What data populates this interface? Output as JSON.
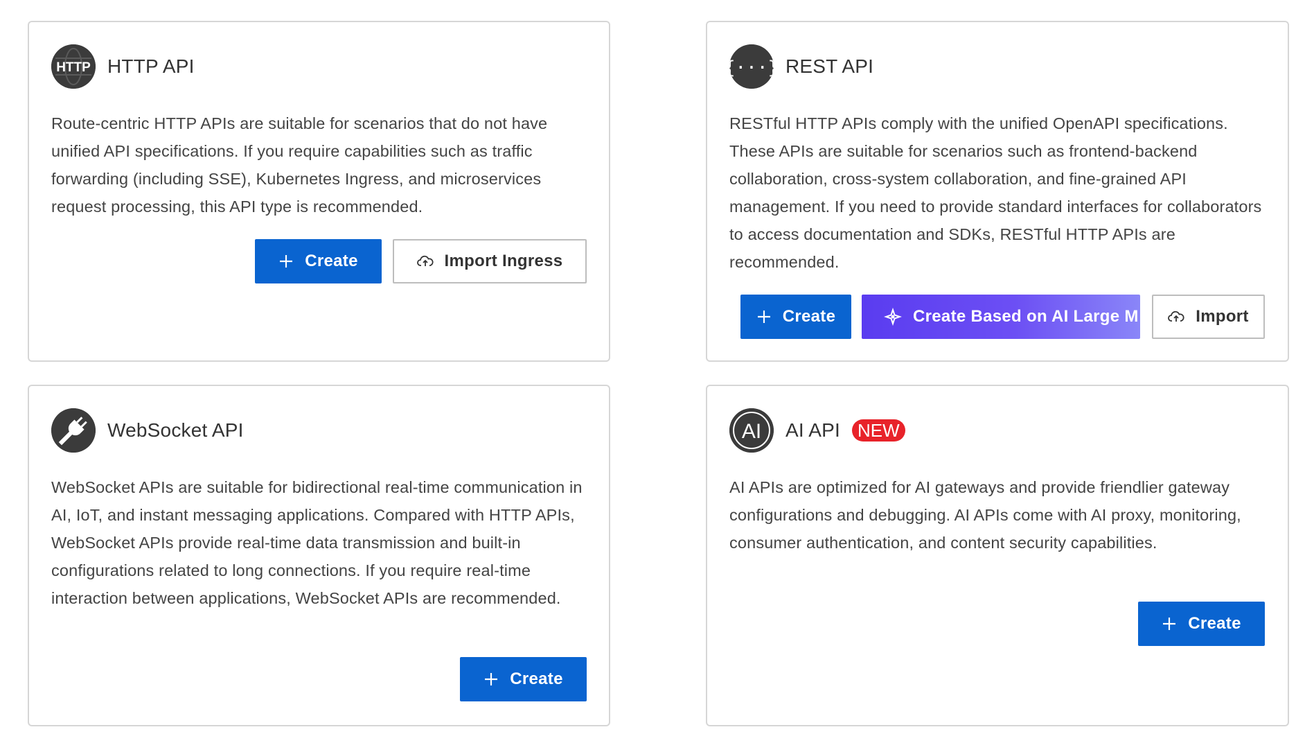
{
  "cards": {
    "http": {
      "logo_text": "HTTP",
      "title": "HTTP API",
      "description": "Route-centric HTTP APIs are suitable for scenarios that do not have unified API specifications. If you require capabilities such as traffic forwarding (including SSE), Kubernetes Ingress, and microservices request processing, this API type is recommended.",
      "buttons": {
        "create": "Create",
        "import_ingress": "Import Ingress"
      },
      "icons": {
        "logo": "globe-http-icon",
        "create": "plus-icon",
        "import": "cloud-upload-icon"
      }
    },
    "rest": {
      "logo_text": "{···}",
      "title": "REST API",
      "description": "RESTful HTTP APIs comply with the unified OpenAPI specifications. These APIs are suitable for scenarios such as frontend-backend collaboration, cross-system collaboration, and fine-grained API management. If you need to provide standard interfaces for collaborators to access documentation and SDKs, RESTful HTTP APIs are recommended.",
      "buttons": {
        "create": "Create",
        "create_ai": "Create Based on AI Large M",
        "import": "Import"
      },
      "icons": {
        "logo": "curly-braces-icon",
        "create": "plus-icon",
        "create_ai": "ai-spark-icon",
        "import": "cloud-upload-icon"
      }
    },
    "websocket": {
      "title": "WebSocket API",
      "description": "WebSocket APIs are suitable for bidirectional real-time communication in AI, IoT, and instant messaging applications. Compared with HTTP APIs, WebSocket APIs provide real-time data transmission and built-in configurations related to long connections. If you require real-time interaction between applications, WebSocket APIs are recommended.",
      "buttons": {
        "create": "Create"
      },
      "icons": {
        "logo": "plug-icon",
        "create": "plus-icon"
      }
    },
    "ai": {
      "logo_text": "AI",
      "title": "AI API",
      "badge": "NEW",
      "description": "AI APIs are optimized for AI gateways and provide friendlier gateway configurations and debugging. AI APIs come with AI proxy, monitoring, consumer authentication, and content security capabilities.",
      "buttons": {
        "create": "Create"
      },
      "icons": {
        "logo": "ai-circle-icon",
        "create": "plus-icon"
      }
    }
  },
  "colors": {
    "primary": "#0a64d0",
    "ai_gradient_start": "#5a3cf0",
    "ai_gradient_end": "#8a86f8",
    "badge_red": "#e8232a",
    "logo_dark": "#3b3b3b",
    "border": "#d6d6d6"
  }
}
